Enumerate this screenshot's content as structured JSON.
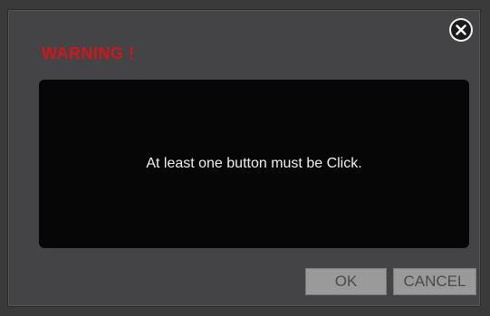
{
  "dialog": {
    "title": "WARNING !",
    "message": "At least one button must be Click.",
    "ok_label": "OK",
    "cancel_label": "CANCEL",
    "close_icon": "close-icon"
  },
  "colors": {
    "title": "#d0161b",
    "dialog_background": "#444446",
    "message_panel": "#060606",
    "button_background": "#9a9a9a"
  }
}
